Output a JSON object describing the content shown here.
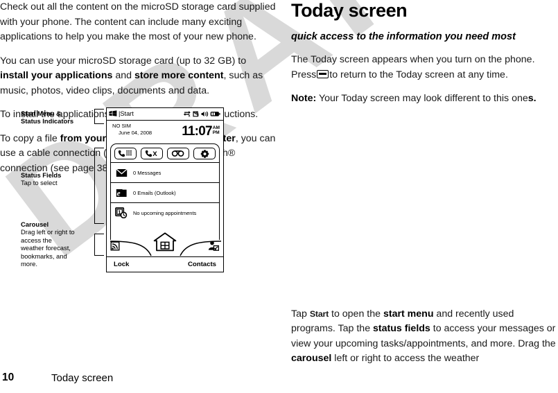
{
  "watermark": {
    "text": "DRAFT"
  },
  "left_column": {
    "paragraphs": [
      {
        "id": "p1",
        "runs": [
          {
            "t": "Check out all the content on the microSD storage card supplied with your phone. The content can include many exciting applications to help you make the most of your new phone.",
            "b": false
          }
        ]
      },
      {
        "id": "p2",
        "runs": [
          {
            "t": "You can use your microSD storage card (up to 32 GB) to ",
            "b": false
          },
          {
            "t": "install your applications",
            "b": true
          },
          {
            "t": " and ",
            "b": false
          },
          {
            "t": "store more content",
            "b": true
          },
          {
            "t": ", such as music, photos, video clips, documents and data.",
            "b": false
          }
        ]
      },
      {
        "id": "p3",
        "runs": [
          {
            "t": "To install the applications, follow the on-screen instructions.",
            "b": false
          }
        ]
      },
      {
        "id": "p4",
        "runs": [
          {
            "t": "To copy a file ",
            "b": false
          },
          {
            "t": "from your storage card to a computer",
            "b": true
          },
          {
            "t": ", you can use a cable connection (see page 40) or a Bluetooth® connection (see page 38).",
            "b": false
          }
        ]
      }
    ]
  },
  "right_column": {
    "title": "Today screen",
    "subtitle": "quick access to the information you need most",
    "intro_part1": "The Today screen appears when you turn on the phone. Press",
    "intro_part2": "to return to the Today screen at any time.",
    "home_key_icon": "home-key-icon",
    "note_label": "Note:",
    "note_text": " Your Today screen may look different to this one",
    "note_tail": "s.",
    "closing": {
      "runs": [
        {
          "t": "Tap ",
          "b": false
        },
        {
          "t": "Start",
          "b": false,
          "ui": true
        },
        {
          "t": " to open the ",
          "b": false
        },
        {
          "t": "start menu",
          "b": true
        },
        {
          "t": " and recently used programs. Tap the ",
          "b": false
        },
        {
          "t": "status fields",
          "b": true
        },
        {
          "t": " to access your messages or view your upcoming tasks/appointments, and more. Drag the ",
          "b": false
        },
        {
          "t": "carousel",
          "b": true
        },
        {
          "t": " left or right to access the weather",
          "b": false
        }
      ]
    }
  },
  "figure": {
    "callouts": [
      {
        "id": "start",
        "heading": "Start Menu &",
        "heading2": "Status Indicators",
        "sub": ""
      },
      {
        "id": "status",
        "heading": "Status Fields",
        "sub": "Tap to select"
      },
      {
        "id": "carousel",
        "heading": "Carousel",
        "sub": "Drag left or right to access the weather forecast, bookmarks, and more."
      }
    ],
    "phone": {
      "start_bar": {
        "logo_icon": "windows-flag-icon",
        "label": "|Start",
        "indicators": [
          {
            "name": "connection-off-icon"
          },
          {
            "name": "sync-icon"
          },
          {
            "name": "volume-icon"
          },
          {
            "name": "battery-icon"
          }
        ]
      },
      "clock": {
        "sim_status": "NO SIM",
        "date": "June 04, 2008",
        "time": "11:07",
        "am": "AM",
        "pm": "PM"
      },
      "quick_links": [
        {
          "name": "phone-keypad-icon",
          "label": ""
        },
        {
          "name": "missed-call-icon",
          "label": ""
        },
        {
          "name": "voicemail-icon",
          "label": ""
        },
        {
          "name": "settings-gear-icon",
          "label": ""
        }
      ],
      "status_fields": [
        {
          "icon": "messages-envelope-icon",
          "label": "0 Messages"
        },
        {
          "icon": "outlook-email-icon",
          "label": "0 Emails (Outlook)"
        },
        {
          "icon": "calendar-clock-icon",
          "label": "No upcoming appointments"
        }
      ],
      "carousel_items": [
        {
          "name": "rss-feed-icon"
        },
        {
          "name": "home-house-icon"
        },
        {
          "name": "contacts-person-icon"
        }
      ],
      "soft_keys": {
        "left": "Lock",
        "right": "Contacts"
      }
    }
  },
  "footer": {
    "page_number": "10",
    "title": "Today screen"
  }
}
